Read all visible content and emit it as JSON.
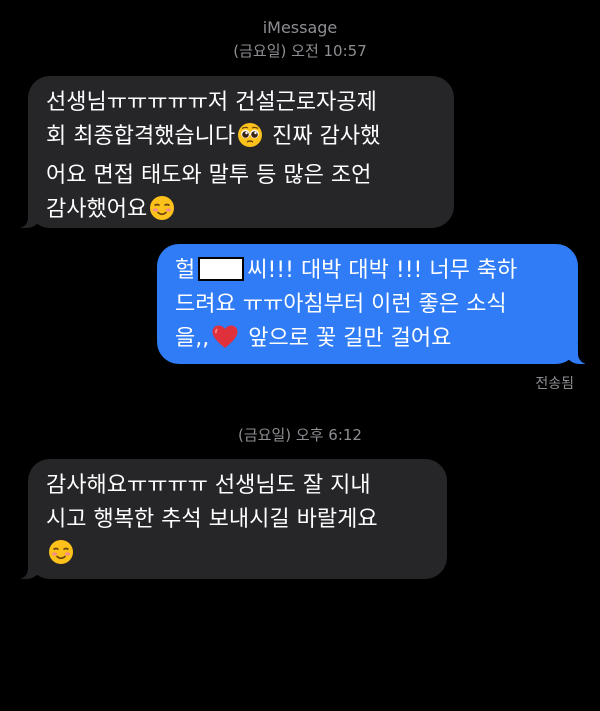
{
  "header": {
    "service": "iMessage",
    "timestamp_1": "(금요일) 오전 10:57",
    "timestamp_2": "(금요일) 오후 6:12"
  },
  "messages": [
    {
      "direction": "incoming",
      "lines": [
        "선생님ㅠㅠㅠㅠㅠ저 건설근로자공제",
        "회 최종합격했습니다",
        " 진짜 감사했",
        "어요 면접 태도와 말투 등 많은 조언",
        "감사했어요"
      ],
      "emojis": [
        "pleading-face",
        "smiling-face"
      ]
    },
    {
      "direction": "outgoing",
      "lines": [
        "헐",
        "씨!!! 대박 대박 !!! 너무 축하",
        "드려요 ㅠㅠ아침부터 이런 좋은 소식",
        "을,,",
        " 앞으로  꽃 길만 걸어요"
      ],
      "emojis": [
        "red-heart"
      ],
      "status": "전송됨"
    },
    {
      "direction": "incoming",
      "lines": [
        "감사해요ㅠㅠㅠㅠ 선생님도 잘 지내",
        "시고 행복한 추석 보내시길 바랄게요"
      ],
      "emojis": [
        "smiling-face"
      ]
    }
  ],
  "colors": {
    "background": "#000000",
    "incoming_bubble": "#262629",
    "outgoing_bubble": "#2f7cf6",
    "meta_text": "#8e8e93"
  }
}
